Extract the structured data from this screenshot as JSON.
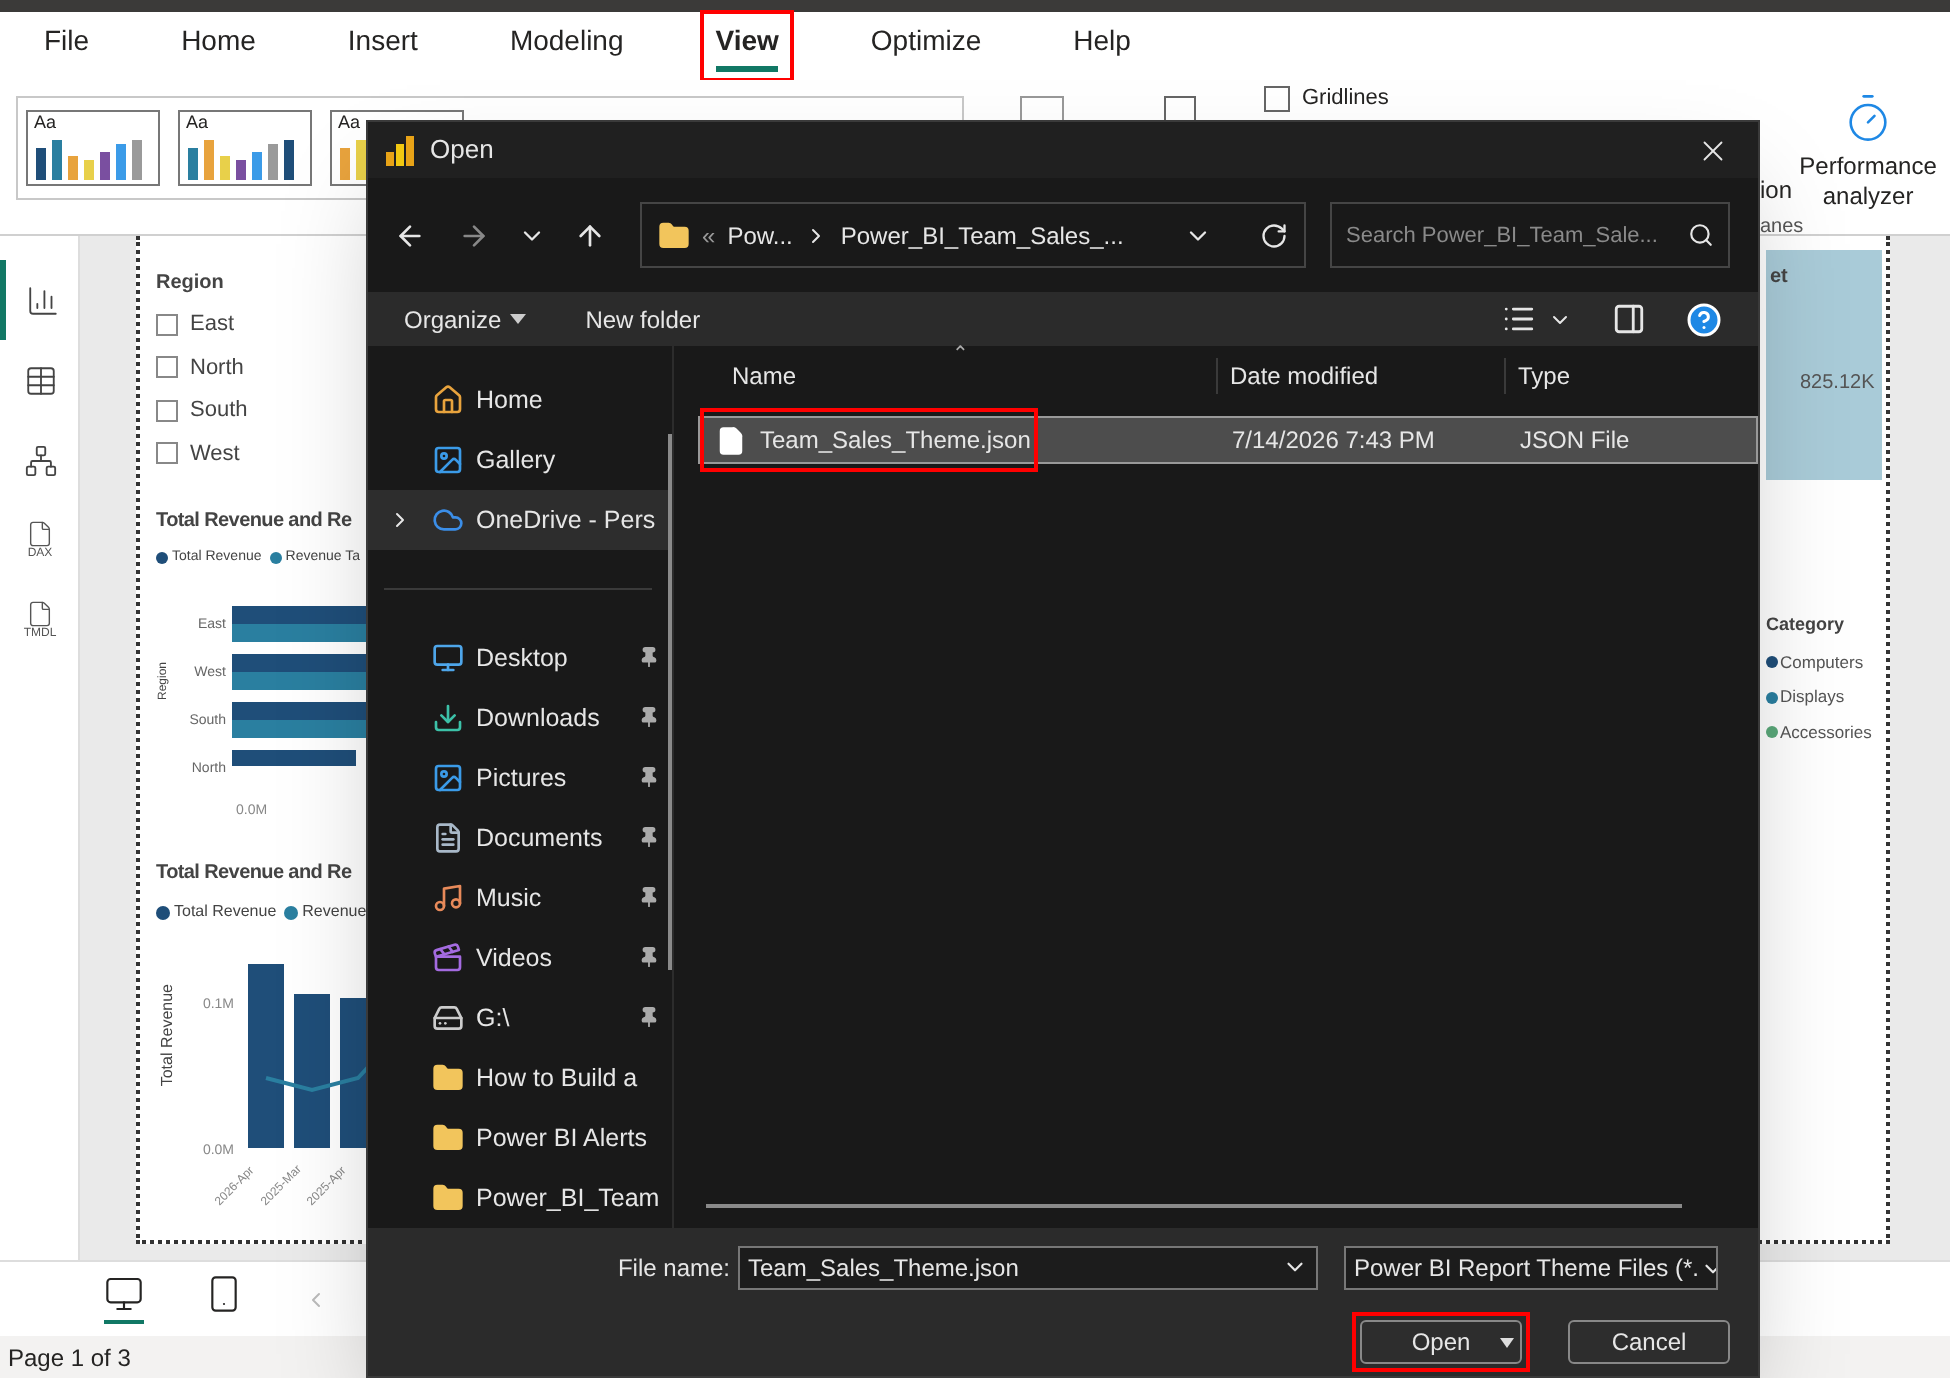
{
  "app": {
    "ribbon_tabs": [
      {
        "label": "File",
        "selected": false,
        "highlighted": false
      },
      {
        "label": "Home",
        "selected": false,
        "highlighted": false
      },
      {
        "label": "Insert",
        "selected": false,
        "highlighted": false
      },
      {
        "label": "Modeling",
        "selected": false,
        "highlighted": false
      },
      {
        "label": "View",
        "selected": true,
        "highlighted": true
      },
      {
        "label": "Optimize",
        "selected": false,
        "highlighted": false
      },
      {
        "label": "Help",
        "selected": false,
        "highlighted": false
      }
    ],
    "themes": [
      {
        "label": "Aa"
      },
      {
        "label": "Aa"
      },
      {
        "label": "Aa"
      }
    ],
    "gridlines": {
      "label": "Gridlines",
      "checked": false
    },
    "ribbon_right": {
      "partial_label": "ion",
      "button": "Performance analyzer",
      "group_label": "anes"
    },
    "views": [
      {
        "kind": "report",
        "selected": true
      },
      {
        "kind": "table",
        "selected": false
      },
      {
        "kind": "model",
        "selected": false
      },
      {
        "kind": "dax",
        "label": "DAX",
        "selected": false
      },
      {
        "kind": "tmdl",
        "label": "TMDL",
        "selected": false
      }
    ],
    "slicer": {
      "title": "Region",
      "items": [
        {
          "label": "East",
          "checked": false
        },
        {
          "label": "North",
          "checked": false
        },
        {
          "label": "South",
          "checked": false
        },
        {
          "label": "West",
          "checked": false
        }
      ]
    },
    "bar_visual": {
      "title": "Total Revenue and Re",
      "legend": [
        "Total Revenue",
        "Revenue Ta"
      ],
      "ylabel": "Region",
      "categories": [
        "East",
        "West",
        "South",
        "North"
      ],
      "xtick": "0.0M"
    },
    "column_visual": {
      "title": "Total Revenue and Re",
      "legend": [
        "Total Revenue",
        "Revenue"
      ],
      "ylabel": "Total Revenue",
      "yticks": [
        "0.1M",
        "0.0M"
      ],
      "categories": [
        "2026-Apr",
        "2025-Mar",
        "2025-Apr"
      ]
    },
    "gauge_visual": {
      "title": "et",
      "value": "825.12K"
    },
    "category_legend": {
      "title": "Category",
      "items": [
        {
          "label": "Computers",
          "color": "#1f4e79"
        },
        {
          "label": "Displays",
          "color": "#2a7fa0"
        },
        {
          "label": "Accessories",
          "color": "#5aa87a"
        }
      ]
    },
    "page_views": [
      {
        "kind": "desktop",
        "selected": true
      },
      {
        "kind": "mobile",
        "selected": false
      }
    ],
    "status_bar": "Page 1 of 3"
  },
  "dialog": {
    "title": "Open",
    "path_overflow": "«",
    "sort_indicator": "⌃",
    "path": [
      "Pow...",
      "Power_BI_Team_Sales_..."
    ],
    "search": {
      "placeholder": "Search Power_BI_Team_Sale..."
    },
    "toolbar": [
      "Organize",
      "New folder"
    ],
    "sidebar": [
      {
        "kind": "home",
        "label": "Home",
        "selected": false,
        "pinned": false
      },
      {
        "kind": "gallery",
        "label": "Gallery",
        "selected": false,
        "pinned": false
      },
      {
        "kind": "cloud",
        "label": "OneDrive - Pers",
        "selected": true,
        "pinned": false
      },
      {
        "kind": "divider"
      },
      {
        "kind": "desktop",
        "label": "Desktop",
        "selected": false,
        "pinned": true
      },
      {
        "kind": "downloads",
        "label": "Downloads",
        "selected": false,
        "pinned": true
      },
      {
        "kind": "pictures",
        "label": "Pictures",
        "selected": false,
        "pinned": true
      },
      {
        "kind": "documents",
        "label": "Documents",
        "selected": false,
        "pinned": true
      },
      {
        "kind": "music",
        "label": "Music",
        "selected": false,
        "pinned": true
      },
      {
        "kind": "videos",
        "label": "Videos",
        "selected": false,
        "pinned": true
      },
      {
        "kind": "drive",
        "label": "G:\\",
        "selected": false,
        "pinned": true
      },
      {
        "kind": "folder",
        "label": "How to Build a",
        "selected": false,
        "pinned": false
      },
      {
        "kind": "folder",
        "label": "Power BI Alerts",
        "selected": false,
        "pinned": false
      },
      {
        "kind": "folder",
        "label": "Power_BI_Team",
        "selected": false,
        "pinned": false
      }
    ],
    "columns": [
      "Name",
      "Date modified",
      "Type"
    ],
    "files": [
      {
        "name": "Team_Sales_Theme.json",
        "date": "7/14/2026 7:43 PM",
        "type": "JSON File",
        "selected": true,
        "highlighted": true
      }
    ],
    "file_name_label": "File name:",
    "file_name": "Team_Sales_Theme.json",
    "file_type": "Power BI Report Theme Files (*.",
    "buttons": [
      {
        "label": "Open",
        "kind": "split",
        "highlighted": true
      },
      {
        "label": "Cancel",
        "kind": "plain",
        "highlighted": false
      }
    ]
  }
}
